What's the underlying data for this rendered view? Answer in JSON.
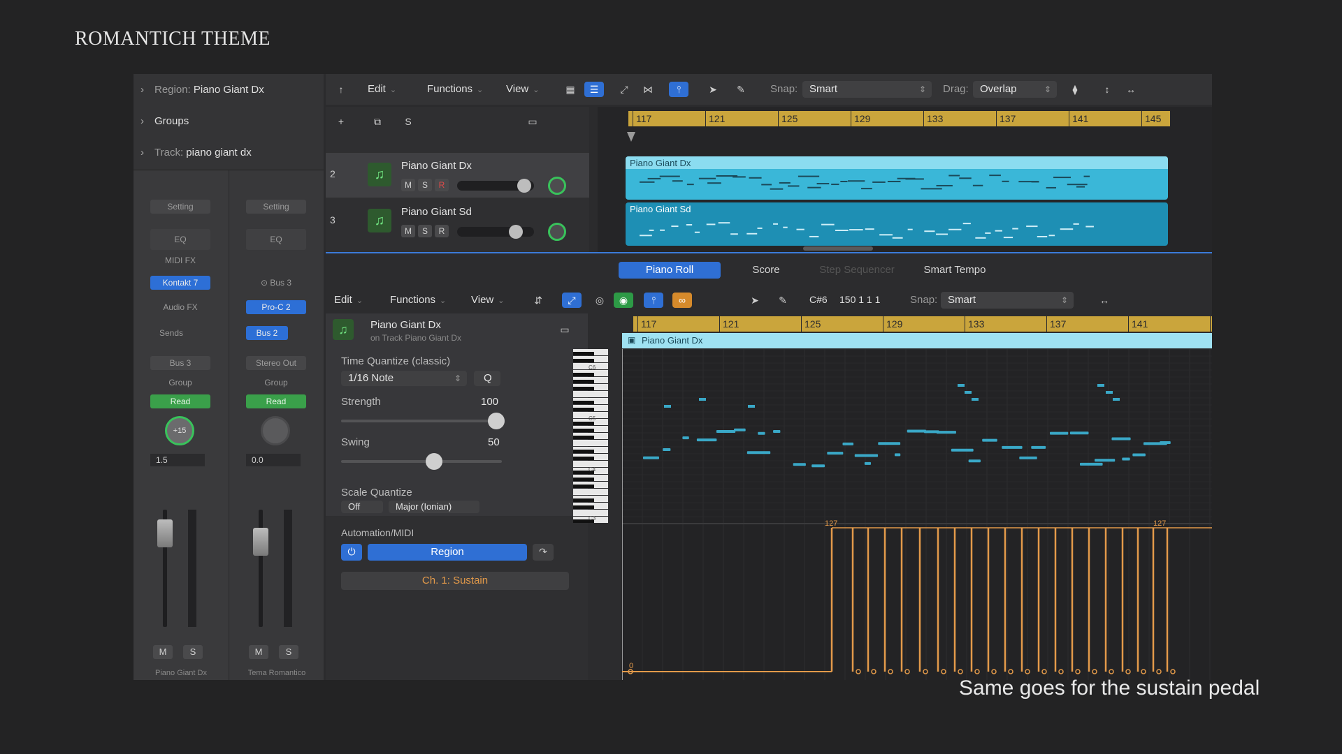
{
  "slide_title": "ROMANTICH THEME",
  "caption": "Same goes for the sustain pedal",
  "inspector": {
    "rows": [
      {
        "label": "Region:",
        "value": "Piano Giant Dx"
      },
      {
        "label": "Groups",
        "value": ""
      },
      {
        "label": "Track:",
        "value": "piano giant dx"
      }
    ],
    "strips": [
      {
        "setting": "Setting",
        "eq": "EQ",
        "midi_fx": "MIDI FX",
        "instrument": "Kontakt 7",
        "audio_fx": "Audio FX",
        "sends": "Sends",
        "output": "Bus 3",
        "group": "Group",
        "automation": "Read",
        "pan": "+15",
        "volume": "1.5",
        "mute": "M",
        "solo": "S",
        "name": "Piano Giant Dx"
      },
      {
        "setting": "Setting",
        "eq": "EQ",
        "input": "Bus 3",
        "plugin": "Pro-C 2",
        "send": "Bus 2",
        "output": "Stereo Out",
        "group": "Group",
        "automation": "Read",
        "volume": "0.0",
        "mute": "M",
        "solo": "S",
        "name": "Tema Romantico"
      }
    ]
  },
  "main_toolbar": {
    "edit": "Edit",
    "functions": "Functions",
    "view": "View",
    "snap_label": "Snap:",
    "snap_value": "Smart",
    "drag_label": "Drag:",
    "drag_value": "Overlap"
  },
  "track_header_buttons": {
    "add": "+",
    "solo": "S"
  },
  "tracks": [
    {
      "number": "2",
      "name": "Piano Giant Dx",
      "mute": "M",
      "solo": "S",
      "record": "R",
      "selected": true
    },
    {
      "number": "3",
      "name": "Piano Giant Sd",
      "mute": "M",
      "solo": "S",
      "record": "R",
      "selected": false
    }
  ],
  "ruler_bars": [
    "117",
    "121",
    "125",
    "129",
    "133",
    "137",
    "141",
    "145"
  ],
  "regions": [
    {
      "name": "Piano Giant Dx",
      "color": "#3ab7d8"
    },
    {
      "name": "Piano Giant Sd",
      "color": "#1e8fb4"
    }
  ],
  "editor": {
    "tabs": [
      "Piano Roll",
      "Score",
      "Step Sequencer",
      "Smart Tempo"
    ],
    "active_tab": "Piano Roll",
    "edit": "Edit",
    "functions": "Functions",
    "view": "View",
    "position_note": "C#6",
    "position_value": "150 1 1 1",
    "snap_label": "Snap:",
    "snap_value": "Smart",
    "region_name": "Piano Giant Dx",
    "region_subtitle": "on Track Piano Giant Dx",
    "time_quantize_label": "Time Quantize (classic)",
    "time_quantize_value": "1/16 Note",
    "quantize_button": "Q",
    "strength_label": "Strength",
    "strength_value": "100",
    "swing_label": "Swing",
    "swing_value": "50",
    "scale_quantize_label": "Scale Quantize",
    "scale_quantize_off": "Off",
    "scale_quantize_mode": "Major (Ionian)",
    "automation_label": "Automation/MIDI",
    "automation_region": "Region",
    "automation_param": "Ch. 1: Sustain",
    "roll_region_label": "Piano Giant Dx",
    "pedal_max_label": "127",
    "pedal_min_label": "0",
    "key_labels": [
      "C6",
      "C5",
      "C4",
      "C3"
    ]
  },
  "colors": {
    "accent_blue": "#2f6fd4",
    "region_cyan": "#3ab7d8",
    "ruler_gold": "#caa53c",
    "pedal_orange": "#e39a4a",
    "note_blue": "#3aa8c7",
    "green": "#39c25b"
  }
}
